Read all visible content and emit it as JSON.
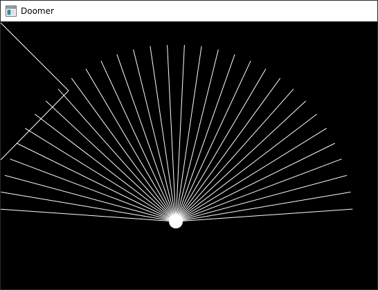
{
  "window": {
    "title": "Doomer",
    "icon": "app-window-icon"
  },
  "scene": {
    "background_color": "#000000",
    "stroke_color": "#ffffff",
    "ray_count": 32
  }
}
